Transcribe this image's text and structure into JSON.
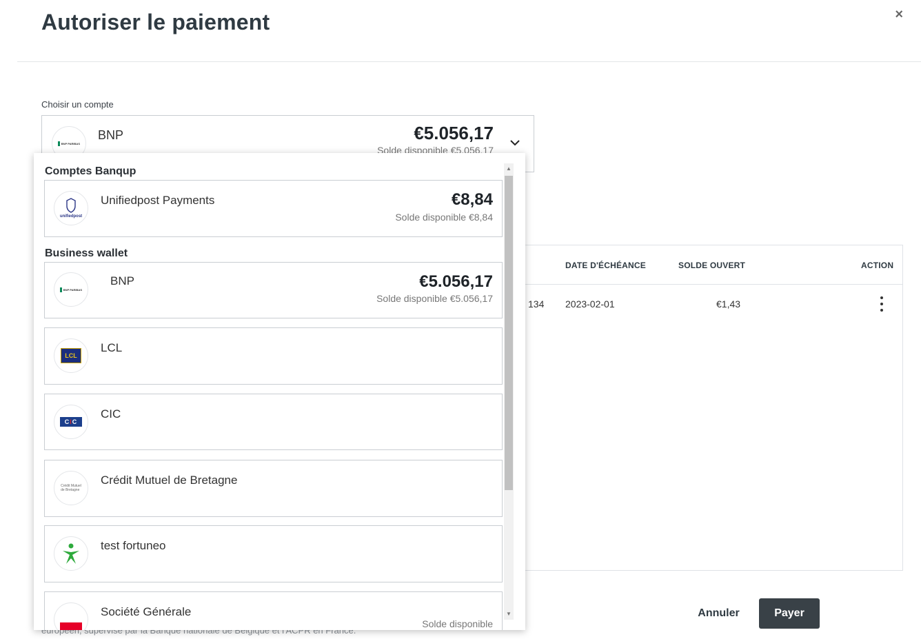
{
  "modal": {
    "title": "Autoriser le paiement",
    "close_label": "×"
  },
  "account_select": {
    "label": "Choisir un compte",
    "selected": {
      "name": "BNP",
      "amount": "€5.056,17",
      "available": "Solde disponible €5.056,17"
    }
  },
  "dropdown": {
    "groups": [
      {
        "title": "Comptes Banqup",
        "items": [
          {
            "name": "Unifiedpost Payments",
            "amount": "€8,84",
            "available": "Solde disponible €8,84",
            "logo": "unifiedpost-logo"
          }
        ]
      },
      {
        "title": "Business wallet",
        "items": [
          {
            "name": "BNP",
            "amount": "€5.056,17",
            "available": "Solde disponible €5.056,17",
            "logo": "bnp-logo"
          },
          {
            "name": "LCL",
            "amount": "",
            "available": "",
            "logo": "lcl-logo"
          },
          {
            "name": "CIC",
            "amount": "",
            "available": "",
            "logo": "cic-logo"
          },
          {
            "name": "Crédit Mutuel de Bretagne",
            "amount": "",
            "available": "",
            "logo": "credit-mutuel-logo"
          },
          {
            "name": "test fortuneo",
            "amount": "",
            "available": "",
            "logo": "fortuneo-logo"
          },
          {
            "name": "Société Générale",
            "amount": "",
            "available": "Solde disponible",
            "logo": "societe-generale-logo"
          }
        ]
      }
    ],
    "logo_text": {
      "bnp": "BNP PARIBAS",
      "unifiedpost": "unifiedpost",
      "lcl": "LCL",
      "cic_left": "C",
      "cic_mid": "I",
      "cic_right": "C",
      "cmb_line1": "Crédit Mutuel",
      "cmb_line2": "de Bretagne"
    }
  },
  "table": {
    "headers": {
      "due_date": "DATE D'ÉCHÉANCE",
      "open_balance": "SOLDE OUVERT",
      "action": "ACTION"
    },
    "rows": [
      {
        "ref_fragment": "134",
        "due_date": "2023-02-01",
        "open_balance": "€1,43"
      }
    ]
  },
  "footer": {
    "legal_text": "européen, supervisé par la Banque nationale de Belgique et l'ACPR en France.",
    "cancel_label": "Annuler",
    "pay_label": "Payer"
  },
  "colors": {
    "primary_button": "#394147",
    "bnp_green": "#0d8a5b",
    "fortuneo_green": "#2eaa3c",
    "sg_red": "#e60028"
  }
}
